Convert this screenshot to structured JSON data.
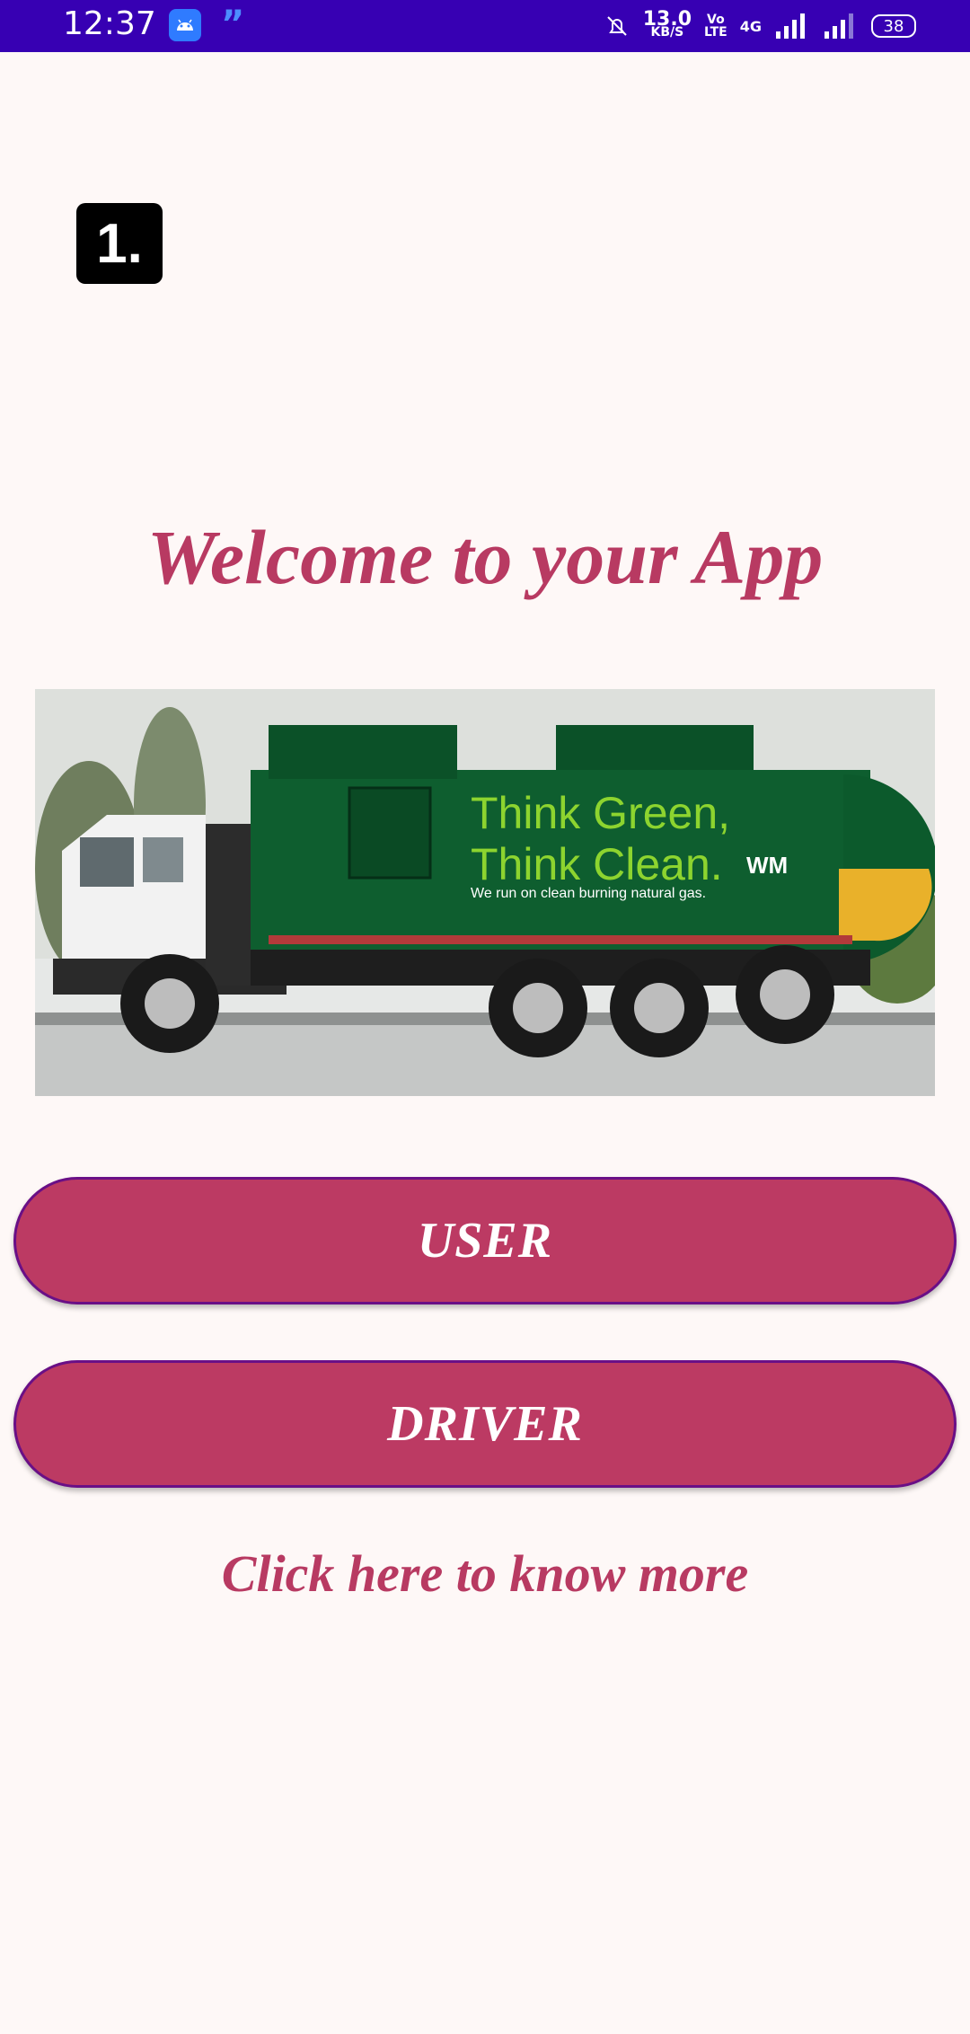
{
  "status_bar": {
    "time": "12:37",
    "net_speed_value": "13.0",
    "net_speed_unit": "KB/S",
    "volte_top": "Vo",
    "volte_bottom": "LTE",
    "network": "4G",
    "battery": "38",
    "background": "#3700B3"
  },
  "logo": {
    "text": "1."
  },
  "title": "Welcome to your App",
  "hero_image": {
    "line1": "Think Green,",
    "line2": "Think Clean.",
    "tagline": "We run on clean burning natural gas.",
    "brand": "WM"
  },
  "buttons": {
    "user": "USER",
    "driver": "DRIVER"
  },
  "link": "Click here to know more",
  "colors": {
    "accent": "#BC3A63",
    "button_border": "#6A0F86",
    "background": "#FEF8F7"
  }
}
